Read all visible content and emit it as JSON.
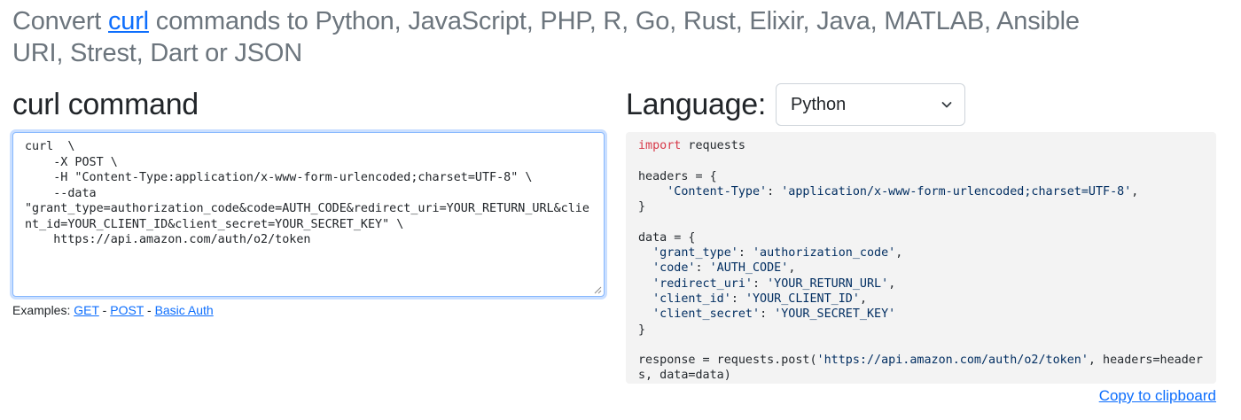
{
  "header": {
    "prefix": "Convert ",
    "link_text": "curl",
    "suffix": " commands to Python, JavaScript, PHP, R, Go, Rust, Elixir, Java, MATLAB, Ansible URI, Strest, Dart or JSON"
  },
  "curl_section": {
    "title": "curl command",
    "input_value": "curl  \\\n    -X POST \\\n    -H \"Content-Type:application/x-www-form-urlencoded;charset=UTF-8\" \\\n    --data\n\"grant_type=authorization_code&code=AUTH_CODE&redirect_uri=YOUR_RETURN_URL&client_id=YOUR_CLIENT_ID&client_secret=YOUR_SECRET_KEY\" \\\n    https://api.amazon.com/auth/o2/token"
  },
  "examples": {
    "label": "Examples: ",
    "links": [
      "GET",
      "POST",
      "Basic Auth"
    ],
    "separator": " - "
  },
  "language": {
    "title": "Language:",
    "selected": "Python"
  },
  "output": {
    "import_kw": "import",
    "import_rest": " requests",
    "headers_open": "headers = {",
    "header_key": "'Content-Type'",
    "header_val": "'application/x-www-form-urlencoded;charset=UTF-8'",
    "close_brace": "}",
    "data_open": "data = {",
    "data_items": [
      {
        "key": "'grant_type'",
        "value": "'authorization_code'"
      },
      {
        "key": "'code'",
        "value": "'AUTH_CODE'"
      },
      {
        "key": "'redirect_uri'",
        "value": "'YOUR_RETURN_URL'"
      },
      {
        "key": "'client_id'",
        "value": "'YOUR_CLIENT_ID'"
      },
      {
        "key": "'client_secret'",
        "value": "'YOUR_SECRET_KEY'"
      }
    ],
    "response_prefix": "response = requests.post(",
    "response_url": "'https://api.amazon.com/auth/o2/token'",
    "response_suffix": ", headers=headers, data=data)"
  },
  "copy_label": "Copy to clipboard",
  "colors": {
    "link": "#0d6efd",
    "keyword": "#d73a49",
    "string": "#032f62",
    "code_bg": "#f3f3f3",
    "focus_border": "#86b7fe"
  }
}
